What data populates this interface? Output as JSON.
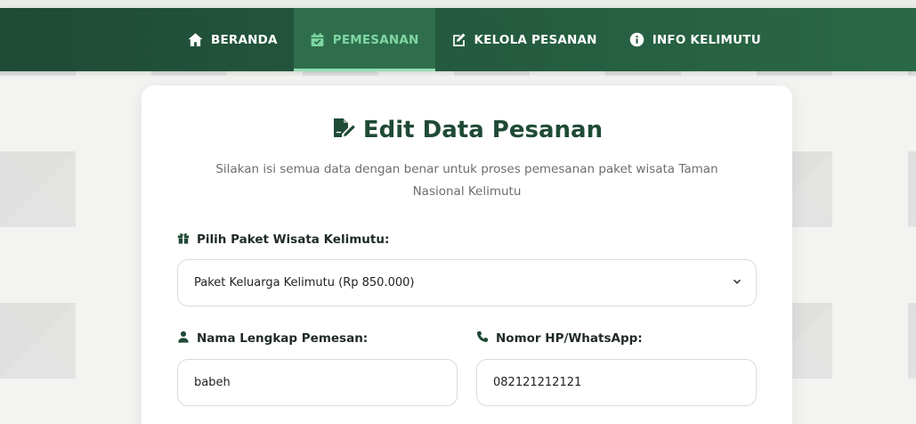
{
  "nav": {
    "items": [
      {
        "label": "BERANDA",
        "icon": "home-icon",
        "active": false
      },
      {
        "label": "PEMESANAN",
        "icon": "calendar-check-icon",
        "active": true
      },
      {
        "label": "KELOLA PESANAN",
        "icon": "edit-icon",
        "active": false
      },
      {
        "label": "INFO KELIMUTU",
        "icon": "info-icon",
        "active": false
      }
    ]
  },
  "form": {
    "title": "Edit Data Pesanan",
    "subtitle": "Silakan isi semua data dengan benar untuk proses pemesanan paket wisata Taman Nasional Kelimutu",
    "package_label": "Pilih Paket Wisata Kelimutu:",
    "package_value": "Paket Keluarga Kelimutu (Rp 850.000)",
    "name_label": "Nama Lengkap Pemesan:",
    "name_value": "babeh",
    "phone_label": "Nomor HP/WhatsApp:",
    "phone_value": "082121212121"
  },
  "colors": {
    "navbar": "#245a3f",
    "active_text": "#7fd6a3",
    "title": "#1f4a36"
  }
}
